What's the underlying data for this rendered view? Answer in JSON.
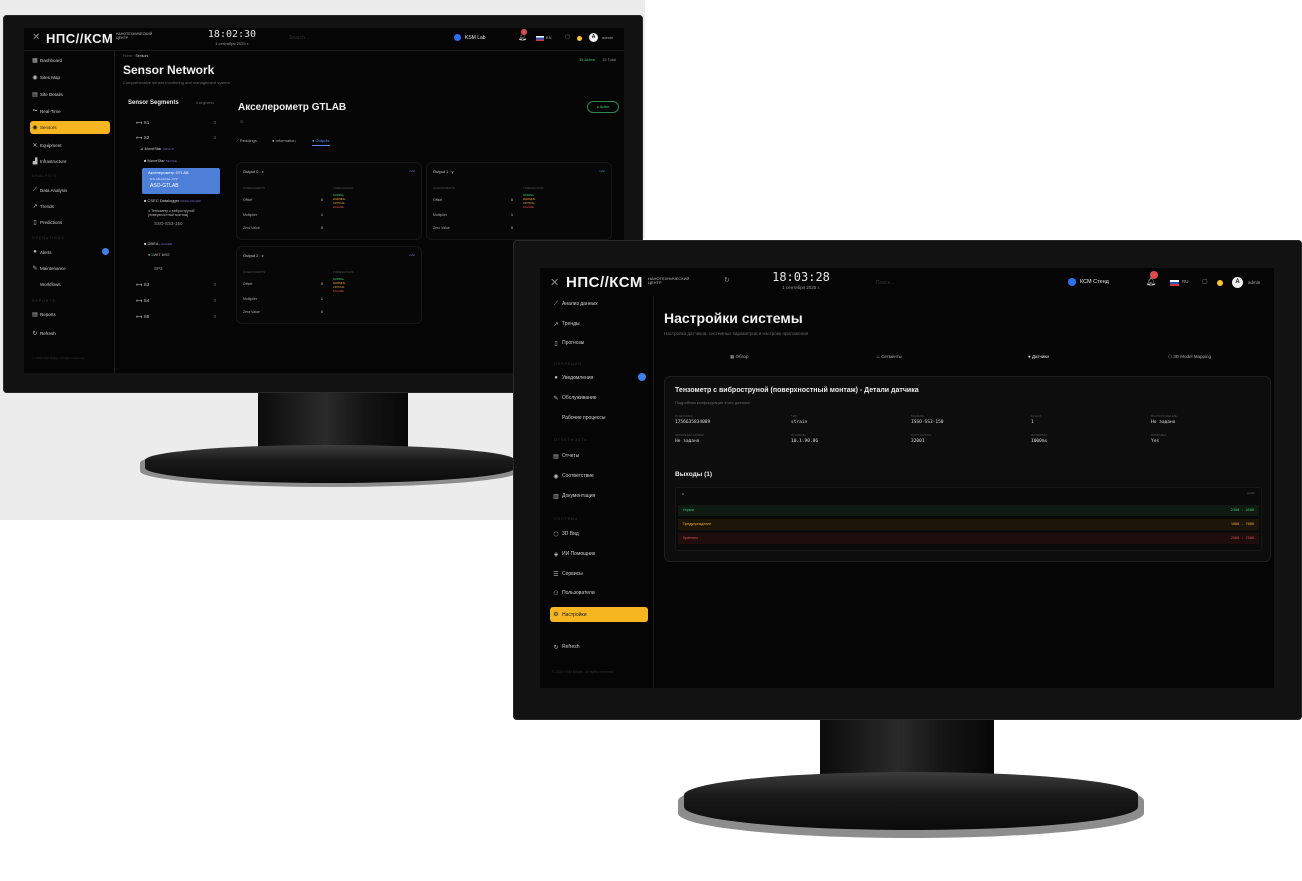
{
  "brand": {
    "logo": "НПС//КСМ",
    "subtitle": "Нанотехнический центр"
  },
  "left": {
    "clock": {
      "time": "18:02:30",
      "date": "1 сентября 2025 г."
    },
    "search_placeholder": "Search...",
    "site_label": "KSM Lab",
    "lang": "EN",
    "user": "admin",
    "avatar": "A",
    "nav": [
      {
        "label": "Dashboard",
        "icon": "▦"
      },
      {
        "label": "Sites Map",
        "icon": "◉"
      },
      {
        "label": "Site Details",
        "icon": "▤"
      },
      {
        "label": "Real-Time",
        "icon": "⏦"
      },
      {
        "label": "Sensors",
        "icon": "◉"
      },
      {
        "label": "Equipment",
        "icon": "✕"
      },
      {
        "label": "Infrastructure",
        "icon": "▟"
      }
    ],
    "section_analysis": "Analysis",
    "nav_analysis": [
      {
        "label": "Data Analysis",
        "icon": "⟋"
      },
      {
        "label": "Trends",
        "icon": "↗"
      },
      {
        "label": "Predictions",
        "icon": "▯"
      }
    ],
    "section_operations": "Operations",
    "nav_operations": [
      {
        "label": "Alerts",
        "icon": "●"
      },
      {
        "label": "Maintenance",
        "icon": "✎"
      },
      {
        "label": "Workflows",
        "icon": ""
      }
    ],
    "section_reports": "Reports",
    "nav_reports": [
      {
        "label": "Reports",
        "icon": "▤"
      },
      {
        "label": "Refresh",
        "icon": "↻"
      }
    ],
    "footer": "© 2025 KSM Bridge. All rights reserved.",
    "breadcrumb": [
      "Home",
      "Sensors"
    ],
    "page_title": "Sensor Network",
    "page_subtitle": "Comprehensive sensor monitoring and management system",
    "stats": {
      "active": "15 Active",
      "total": "15 Total"
    },
    "segments_title": "Sensor Segments",
    "segments_count": "5 segments",
    "segments": [
      {
        "name": "S1",
        "count": "3"
      },
      {
        "name": "S2",
        "count": "3"
      }
    ],
    "tree": {
      "group": "MoveStar",
      "group_tag": "GROUP",
      "device": "MoveStar",
      "device_tag": "DEVICE",
      "sensor_selected": {
        "name": "Акселерометр GTLAB",
        "model": "GTLAB-ACCEL-XYZ",
        "id": "ASO-GTLAB"
      },
      "device2": "CSEC Datalogger",
      "device2_tag": "DATALOGGER",
      "sensor2": {
        "name": "Тензометр с виброструной (поверхностный монтаж)",
        "id": "SSO-SS3-150"
      },
      "device3": "DBEA",
      "device3_tag": "LOGGER",
      "sensor3": {
        "name": "LWIT 6/92",
        "id": "SP3"
      }
    },
    "segments_more": [
      {
        "name": "S3",
        "count": "3"
      },
      {
        "name": "S4",
        "count": "3"
      },
      {
        "name": "S5",
        "count": "3"
      }
    ],
    "detail_title": "Акселерометр GTLAB",
    "detail_sub": "ID",
    "status": "Active",
    "tabs": [
      "Readings",
      "Information",
      "Outputs"
    ],
    "outputs": [
      {
        "title": "Output 0 : x",
        "unit": "m/s²"
      },
      {
        "title": "Output 1 : y",
        "unit": "m/s²"
      },
      {
        "title": "Output 2 : z",
        "unit": "m/s²"
      }
    ],
    "coef_label": "Coefficients",
    "thr_label": "Thresholds",
    "coef_rows": [
      {
        "label": "Offset",
        "value": "0"
      },
      {
        "label": "Multiplier",
        "value": "1"
      },
      {
        "label": "Zero Value",
        "value": "0"
      }
    ],
    "thresholds": [
      "NORMAL",
      "WARNING",
      "CRITICAL",
      "FAILURE"
    ]
  },
  "right": {
    "clock": {
      "time": "18:03:28",
      "date": "1 сентября 2025 г."
    },
    "search_placeholder": "Поиск...",
    "site_label": "КСМ Стенд",
    "lang": "RU",
    "user": "admin",
    "avatar": "A",
    "nav_top": [
      {
        "label": "Анализ данных",
        "icon": "⟋"
      },
      {
        "label": "Тренды",
        "icon": "↗"
      },
      {
        "label": "Прогнозы",
        "icon": "▯"
      }
    ],
    "section_ops": "Операции",
    "nav_ops": [
      {
        "label": "Уведомления",
        "icon": "●"
      },
      {
        "label": "Обслуживание",
        "icon": "✎"
      },
      {
        "label": "Рабочие процессы",
        "icon": ""
      }
    ],
    "section_reports": "Отчетность",
    "nav_reports": [
      {
        "label": "Отчеты",
        "icon": "▤"
      },
      {
        "label": "Соответствие",
        "icon": "◉"
      },
      {
        "label": "Документация",
        "icon": "▥"
      }
    ],
    "section_system": "Система",
    "nav_system": [
      {
        "label": "3D Вид",
        "icon": "⬡"
      },
      {
        "label": "ИИ Помощник",
        "icon": "◈"
      },
      {
        "label": "Сервисы",
        "icon": "☰"
      },
      {
        "label": "Пользователи",
        "icon": "⚇"
      },
      {
        "label": "Настройки",
        "icon": "⚙"
      }
    ],
    "refresh": "Refresh",
    "footer": "© 2025 KSM Bridge. All rights reserved.",
    "page_title": "Настройки системы",
    "page_subtitle": "Настройка датчиков, системных параметров и настроек приложения",
    "tabs": [
      {
        "label": "Обзор",
        "icon": "▦"
      },
      {
        "label": "Сегменты",
        "icon": "⊥"
      },
      {
        "label": "Датчики",
        "icon": "●"
      },
      {
        "label": "3D Model Mapping",
        "icon": "⬡"
      }
    ],
    "detail": {
      "title": "Тензометр с виброструной (поверхностный монтаж) - Детали датчика",
      "subtitle": "Подробная конфигурация этого датчика",
      "fields_row1": [
        {
          "label": "ID датчика",
          "value": "1756635834089"
        },
        {
          "label": "Тип",
          "value": "strain"
        },
        {
          "label": "Модель",
          "value": "ISSO-SS3-150"
        },
        {
          "label": "Канал",
          "value": "1"
        },
        {
          "label": "Расположение",
          "value": "Не задано"
        }
      ],
      "fields_row2": [
        {
          "label": "Серийный номер",
          "value": "Не задано"
        },
        {
          "label": "IP шлюза",
          "value": "10.1.90.86"
        },
        {
          "label": "Порт шлюза",
          "value": "32001"
        },
        {
          "label": "Интервал",
          "value": "1000ms"
        },
        {
          "label": "Включен",
          "value": "Yes"
        }
      ],
      "outputs_title": "Выходы (1)",
      "out_col": "x",
      "out_unit": "µm/m",
      "out_rows": [
        {
          "label": "Норма",
          "range": "2300 - 4500",
          "color": "#3ccf6e",
          "bg": "#0e1a12"
        },
        {
          "label": "Предупреждение",
          "range": "1000 - 7000",
          "color": "#f0a733",
          "bg": "#1e1509"
        },
        {
          "label": "Критично",
          "range": "2500 - 7500",
          "color": "#e85050",
          "bg": "#1f0c0c"
        }
      ]
    }
  }
}
